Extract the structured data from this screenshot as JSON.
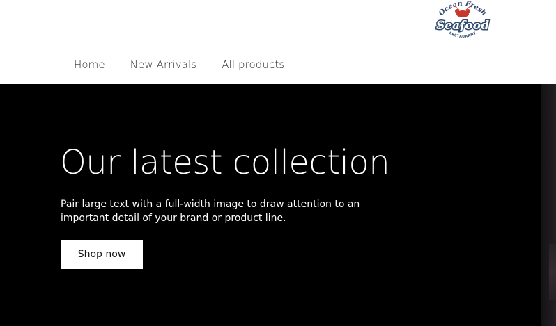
{
  "brand": {
    "logo_top_text": "Ocean Fresh",
    "logo_main_text": "Seafood",
    "logo_bottom_text": "RESTAURANT",
    "logo_icon": "lobster-icon",
    "colors": {
      "logo_blue": "#2f4a6b",
      "logo_red": "#c8372d"
    }
  },
  "nav": {
    "items": [
      {
        "label": "Home"
      },
      {
        "label": "New Arrivals"
      },
      {
        "label": "All products"
      }
    ]
  },
  "hero": {
    "title": "Our latest collection",
    "text": "Pair large text with a full-width image to draw attention to an important detail of your brand or product line.",
    "button_label": "Shop now",
    "colors": {
      "background": "#000000",
      "text": "#ffffff",
      "button_bg": "#ffffff",
      "button_text": "#121212"
    }
  }
}
